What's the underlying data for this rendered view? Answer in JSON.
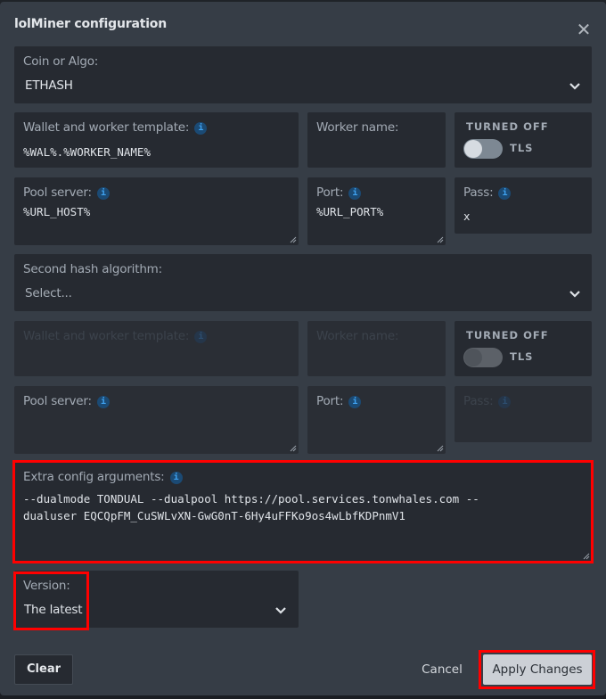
{
  "dialog": {
    "title": "lolMiner configuration",
    "close_icon": "close-icon"
  },
  "coin": {
    "label": "Coin or Algo:",
    "value": "ETHASH"
  },
  "primary": {
    "wallet_label": "Wallet and worker template:",
    "wallet_value": "%WAL%.%WORKER_NAME%",
    "worker_label": "Worker name:",
    "worker_value": "",
    "tls_caption": "TURNED OFF",
    "tls_label": "TLS",
    "tls_on": false,
    "pool_label": "Pool server:",
    "pool_value": "%URL_HOST%",
    "port_label": "Port:",
    "port_value": "%URL_PORT%",
    "pass_label": "Pass:",
    "pass_value": "x"
  },
  "second_algo": {
    "label": "Second hash algorithm:",
    "placeholder": "Select..."
  },
  "secondary": {
    "wallet_label": "Wallet and worker template:",
    "worker_label": "Worker name:",
    "tls_caption": "TURNED OFF",
    "tls_label": "TLS",
    "tls_on": false,
    "pool_label": "Pool server:",
    "port_label": "Port:",
    "pass_label": "Pass:"
  },
  "extra": {
    "label": "Extra config arguments:",
    "value": "--dualmode TONDUAL --dualpool https://pool.services.tonwhales.com --\ndualuser EQCQpFM_CuSWLvXN-GwG0nT-6Hy4uFFKo9os4wLbfKDPnmV1"
  },
  "version": {
    "label": "Version:",
    "value": "The latest"
  },
  "footer": {
    "clear": "Clear",
    "cancel": "Cancel",
    "apply": "Apply Changes"
  },
  "info_glyph": "i",
  "close_glyph": "✕",
  "colors": {
    "highlight": "#ff0000",
    "info_icon": "#3fa2f0",
    "modal_bg": "#363d46",
    "panel_bg": "#262a31"
  }
}
